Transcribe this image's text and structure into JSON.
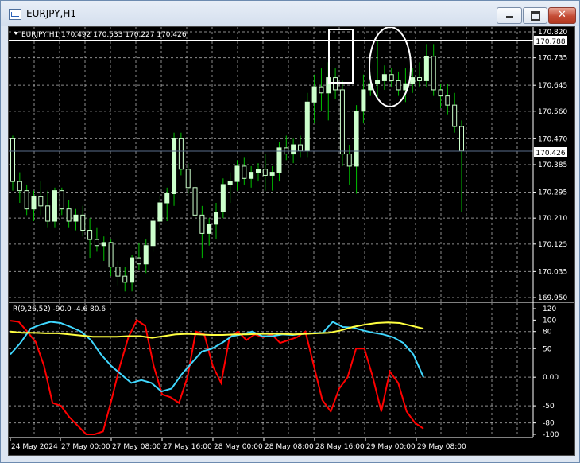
{
  "window": {
    "title": "EURJPY,H1"
  },
  "main_header": "EURJPY,H1  170.492 170.533 170.227 170.426",
  "indicator_header": "R(9,26,52) -90.0 -4.6 80.6",
  "price_axis": [
    "170.820",
    "170.735",
    "170.645",
    "170.560",
    "170.470",
    "170.385",
    "170.295",
    "170.210",
    "170.125",
    "170.035",
    "169.950"
  ],
  "price_markers": {
    "upper": "170.788",
    "current": "170.426"
  },
  "indicator_axis": [
    "120",
    "100",
    "80",
    "50",
    "0.00",
    "-50",
    "-80",
    "-100"
  ],
  "time_axis": [
    "24 May 2024",
    "27 May 00:00",
    "27 May 08:00",
    "27 May 16:00",
    "28 May 00:00",
    "28 May 08:00",
    "28 May 16:00",
    "29 May 00:00",
    "29 May 08:00"
  ],
  "colors": {
    "bull_candle": "#ccffcc",
    "candle_wick": "#00c000",
    "grid": "#c8c8c8",
    "red_line": "#ff0000",
    "cyan_line": "#40d8ff",
    "yellow_line": "#ffff40",
    "window_frame": "#6d8bb0",
    "close_button": "#c44b34"
  },
  "icons": {
    "app": "chart-window-icon",
    "minimize": "minimize-icon",
    "maximize": "maximize-icon",
    "close": "close-icon",
    "menu": "triangle-down-icon"
  },
  "chart_data": {
    "type": "candlestick",
    "price_range": [
      169.95,
      170.82
    ],
    "candles": [
      [
        170.47,
        170.48,
        170.3,
        170.33
      ],
      [
        170.33,
        170.36,
        170.26,
        170.3
      ],
      [
        170.3,
        170.32,
        170.22,
        170.24
      ],
      [
        170.24,
        170.3,
        170.2,
        170.28
      ],
      [
        170.28,
        170.33,
        170.22,
        170.25
      ],
      [
        170.25,
        170.3,
        170.18,
        170.2
      ],
      [
        170.2,
        170.31,
        170.18,
        170.3
      ],
      [
        170.3,
        170.31,
        170.22,
        170.24
      ],
      [
        170.24,
        170.27,
        170.18,
        170.2
      ],
      [
        170.2,
        170.24,
        170.17,
        170.22
      ],
      [
        170.22,
        170.25,
        170.15,
        170.17
      ],
      [
        170.17,
        170.21,
        170.08,
        170.14
      ],
      [
        170.14,
        170.18,
        170.1,
        170.12
      ],
      [
        170.12,
        170.15,
        170.07,
        170.13
      ],
      [
        170.13,
        170.14,
        170.02,
        170.05
      ],
      [
        170.05,
        170.07,
        169.99,
        170.02
      ],
      [
        170.02,
        170.05,
        169.97,
        170.0
      ],
      [
        170.0,
        170.09,
        169.97,
        170.08
      ],
      [
        170.08,
        170.13,
        170.04,
        170.06
      ],
      [
        170.06,
        170.14,
        170.03,
        170.12
      ],
      [
        170.12,
        170.21,
        170.1,
        170.2
      ],
      [
        170.2,
        170.28,
        170.17,
        170.26
      ],
      [
        170.26,
        170.31,
        170.2,
        170.29
      ],
      [
        170.29,
        170.49,
        170.25,
        170.47
      ],
      [
        170.47,
        170.49,
        170.35,
        170.37
      ],
      [
        170.37,
        170.39,
        170.29,
        170.31
      ],
      [
        170.31,
        170.33,
        170.2,
        170.22
      ],
      [
        170.22,
        170.25,
        170.08,
        170.16
      ],
      [
        170.16,
        170.21,
        170.12,
        170.19
      ],
      [
        170.19,
        170.26,
        170.14,
        170.23
      ],
      [
        170.23,
        170.34,
        170.21,
        170.32
      ],
      [
        170.32,
        170.36,
        170.26,
        170.33
      ],
      [
        170.33,
        170.4,
        170.3,
        170.38
      ],
      [
        170.38,
        170.41,
        170.32,
        170.34
      ],
      [
        170.34,
        170.38,
        170.31,
        170.36
      ],
      [
        170.36,
        170.39,
        170.33,
        170.37
      ],
      [
        170.37,
        170.42,
        170.3,
        170.35
      ],
      [
        170.35,
        170.38,
        170.3,
        170.36
      ],
      [
        170.36,
        170.46,
        170.33,
        170.44
      ],
      [
        170.44,
        170.48,
        170.4,
        170.42
      ],
      [
        170.42,
        170.47,
        170.39,
        170.45
      ],
      [
        170.45,
        170.48,
        170.41,
        170.43
      ],
      [
        170.43,
        170.62,
        170.41,
        170.59
      ],
      [
        170.59,
        170.68,
        170.52,
        170.64
      ],
      [
        170.64,
        170.7,
        170.56,
        170.62
      ],
      [
        170.62,
        170.72,
        170.53,
        170.67
      ],
      [
        170.67,
        170.7,
        170.6,
        170.63
      ],
      [
        170.63,
        170.66,
        170.38,
        170.42
      ],
      [
        170.42,
        170.45,
        170.32,
        170.38
      ],
      [
        170.38,
        170.58,
        170.29,
        170.56
      ],
      [
        170.56,
        170.68,
        170.52,
        170.63
      ],
      [
        170.63,
        170.68,
        170.61,
        170.65
      ],
      [
        170.65,
        170.79,
        170.6,
        170.66
      ],
      [
        170.66,
        170.71,
        170.63,
        170.68
      ],
      [
        170.68,
        170.7,
        170.64,
        170.66
      ],
      [
        170.66,
        170.69,
        170.61,
        170.63
      ],
      [
        170.63,
        170.7,
        170.59,
        170.65
      ],
      [
        170.65,
        170.7,
        170.62,
        170.67
      ],
      [
        170.67,
        170.72,
        170.64,
        170.66
      ],
      [
        170.66,
        170.78,
        170.64,
        170.74
      ],
      [
        170.74,
        170.78,
        170.61,
        170.63
      ],
      [
        170.63,
        170.65,
        170.57,
        170.61
      ],
      [
        170.61,
        170.65,
        170.55,
        170.58
      ],
      [
        170.58,
        170.62,
        170.49,
        170.51
      ],
      [
        170.51,
        170.53,
        170.23,
        170.43
      ]
    ],
    "series": [
      {
        "name": "red",
        "values": [
          99,
          97,
          80,
          62,
          20,
          -45,
          -50,
          -70,
          -85,
          -100,
          -100,
          -95,
          -40,
          20,
          70,
          100,
          90,
          20,
          -30,
          -35,
          -45,
          0,
          80,
          75,
          20,
          -10,
          70,
          80,
          65,
          75,
          70,
          75,
          60,
          65,
          70,
          80,
          20,
          -40,
          -60,
          -20,
          0,
          50,
          50,
          0,
          -60,
          10,
          -10,
          -60,
          -80,
          -90
        ]
      },
      {
        "name": "cyan",
        "values": [
          40,
          60,
          85,
          92,
          97,
          95,
          88,
          80,
          65,
          40,
          20,
          5,
          -10,
          -5,
          -10,
          -25,
          -20,
          5,
          25,
          45,
          50,
          60,
          72,
          75,
          80,
          72,
          72,
          75,
          74,
          76,
          77,
          78,
          97,
          88,
          87,
          82,
          78,
          75,
          70,
          60,
          40,
          0
        ]
      },
      {
        "name": "yellow",
        "values": [
          80,
          78,
          78,
          77,
          77,
          75,
          73,
          71,
          71,
          71,
          72,
          72,
          69,
          72,
          75,
          76,
          75,
          74,
          74,
          75,
          75,
          76,
          76,
          76,
          75,
          76,
          77,
          78,
          82,
          88,
          92,
          95,
          96,
          95,
          90,
          85
        ]
      }
    ],
    "indicator_range": [
      -100,
      120
    ],
    "annotations": [
      "rectangle",
      "ellipse"
    ]
  }
}
